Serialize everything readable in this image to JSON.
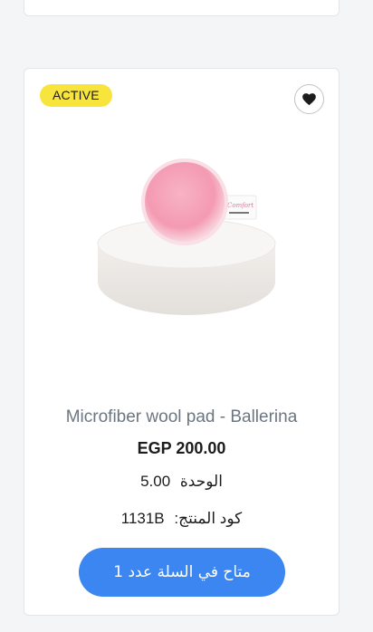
{
  "product": {
    "badge": "ACTIVE",
    "title": "Microfiber wool pad - Ballerina",
    "price": "EGP 200.00",
    "unit_value": "5.00",
    "unit_label": "الوحدة",
    "sku_label": "كود المنتج:",
    "sku_value": "1131B",
    "cart_button": "متاح في السلة عدد 1",
    "colors": {
      "badge": "#f7e53d",
      "button": "#3b86f0",
      "title": "#6b7680"
    },
    "icons": {
      "favorite": "heart-icon"
    },
    "image_tag_text": "Comfort"
  }
}
